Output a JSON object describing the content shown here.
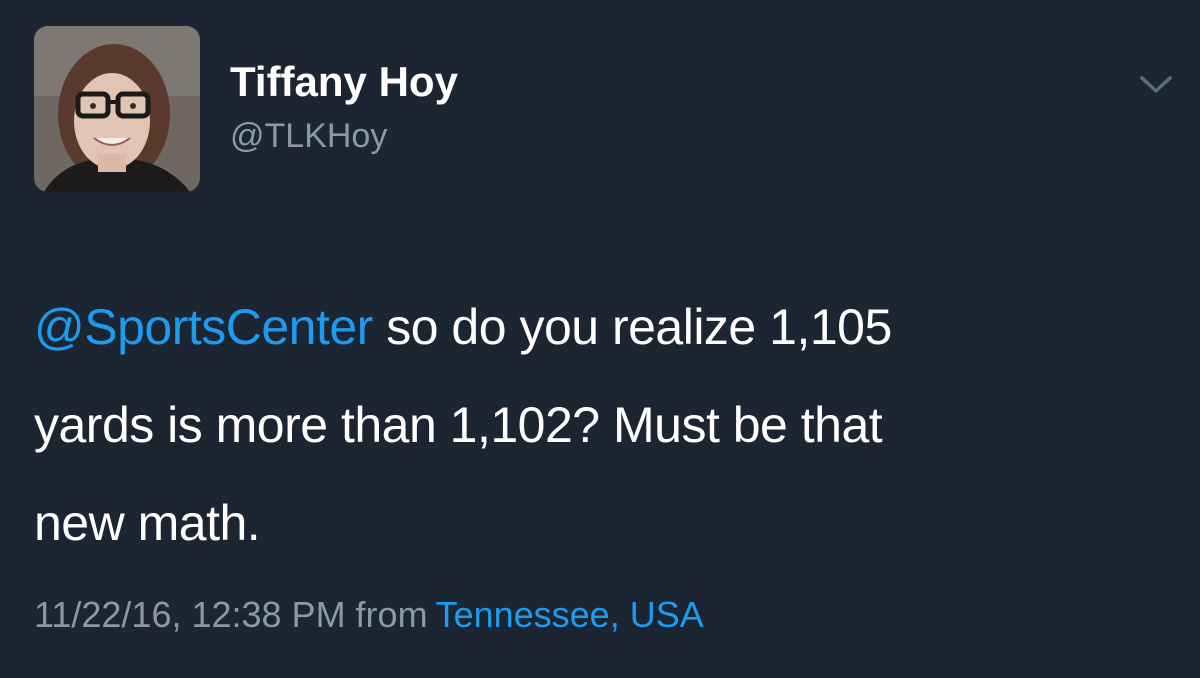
{
  "user": {
    "display_name": "Tiffany Hoy",
    "handle": "@TLKHoy"
  },
  "tweet": {
    "mention": "@SportsCenter",
    "line1_rest": " so do you realize 1,105",
    "line2": "yards is more than 1,102? Must be that",
    "line3": "new math.",
    "timestamp": "11/22/16, 12:38 PM from",
    "location": "Tennessee, USA"
  },
  "icons": {
    "menu": "chevron-down-icon",
    "avatar": "profile-photo"
  },
  "colors": {
    "background": "#1c2532",
    "link": "#1d9bf0",
    "secondary_text": "#8b98a5",
    "primary_text": "#ffffff"
  }
}
